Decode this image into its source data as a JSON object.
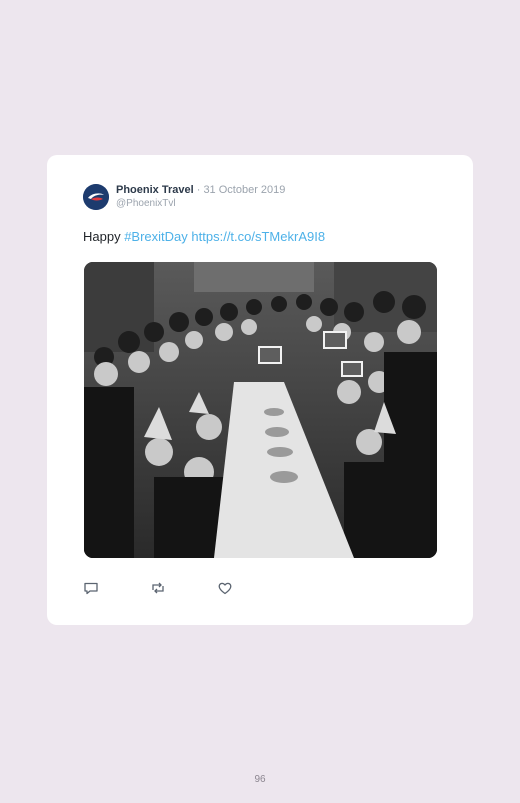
{
  "tweet": {
    "author_name": "Phoenix Travel",
    "separator": " · ",
    "date": "31 October 2019",
    "handle": "@PhoenixTvl",
    "text_prefix": "Happy ",
    "hashtag": "#BrexitDay",
    "link": "https://t.co/sTMekrA9I8"
  },
  "icons": {
    "avatar": "phoenix-logo",
    "reply": "speech-bubble-icon",
    "retweet": "retweet-arrows-icon",
    "like": "heart-icon"
  },
  "colors": {
    "background": "#ede6ee",
    "card": "#ffffff",
    "link": "#4db1e8",
    "author": "#2d3a4a",
    "muted": "#9ba3ad",
    "avatar": "#1d3b6e"
  },
  "footer": {
    "page_number": "96"
  }
}
